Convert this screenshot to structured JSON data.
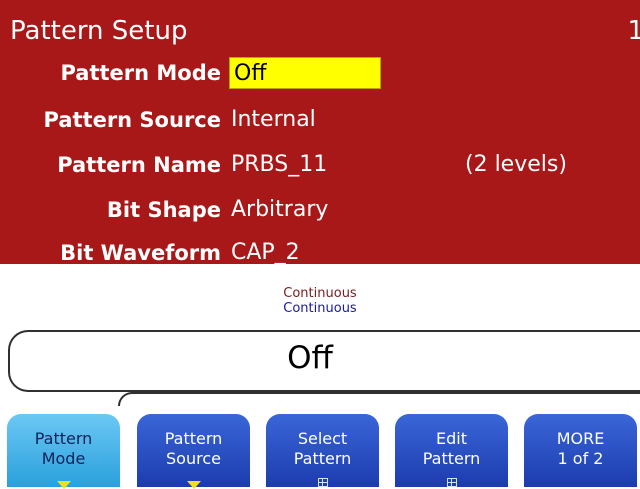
{
  "header": {
    "title": "Pattern Setup",
    "corner": "1"
  },
  "fields": [
    {
      "label": "Pattern Mode",
      "value": "Off",
      "extra": ""
    },
    {
      "label": "Pattern Source",
      "value": "Internal",
      "extra": ""
    },
    {
      "label": "Pattern Name",
      "value": "PRBS_11",
      "extra": "(2 levels)"
    },
    {
      "label": "Bit Shape",
      "value": "Arbitrary",
      "extra": ""
    },
    {
      "label": "Bit Waveform",
      "value": "CAP_2",
      "extra": ""
    }
  ],
  "status": {
    "line1": "Continuous",
    "line2": "Continuous"
  },
  "display": {
    "value": "Off"
  },
  "softkeys": [
    {
      "line1": "Pattern",
      "line2": "Mode",
      "indicator": "arrow-down"
    },
    {
      "line1": "Pattern",
      "line2": "Source",
      "indicator": "arrow-down"
    },
    {
      "line1": "Select",
      "line2": "Pattern",
      "indicator": "menu-grid"
    },
    {
      "line1": "Edit",
      "line2": "Pattern",
      "indicator": "menu-grid"
    },
    {
      "line1": "MORE",
      "line2": "1 of 2",
      "indicator": ""
    }
  ],
  "colors": {
    "panel": "#a81818",
    "highlight": "#ffff00",
    "softkey": "#2a4ec4",
    "softkey_active": "#4ab8ec",
    "indicator_arrow": "#f0e020"
  }
}
